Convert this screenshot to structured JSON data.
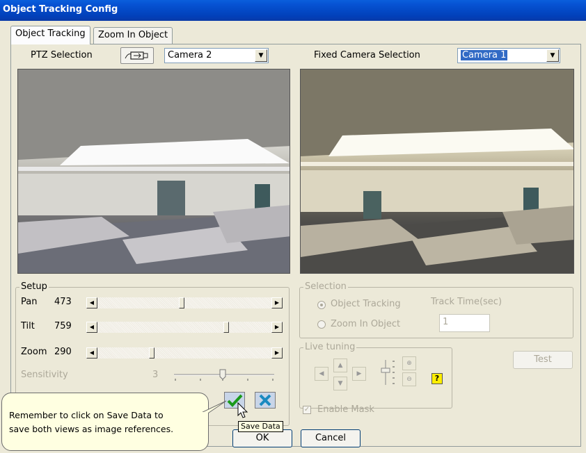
{
  "window": {
    "title": "Object Tracking Config"
  },
  "tabs": [
    {
      "label": "Object Tracking",
      "active": true
    },
    {
      "label": "Zoom In Object",
      "active": false
    }
  ],
  "ptz": {
    "label": "PTZ Selection",
    "camera": "Camera 2"
  },
  "fixed": {
    "label": "Fixed Camera Selection",
    "camera": "Camera 1"
  },
  "setup": {
    "label": "Setup",
    "pan_label": "Pan",
    "pan_value": "473",
    "tilt_label": "Tilt",
    "tilt_value": "759",
    "zoom_label": "Zoom",
    "zoom_value": "290",
    "sensitivity_label": "Sensitivity",
    "sensitivity_value": "3"
  },
  "selection": {
    "label": "Selection",
    "object_tracking": "Object Tracking",
    "zoom_in_object": "Zoom In Object",
    "track_time_label": "Track Time(sec)",
    "track_time_value": "1"
  },
  "live_tuning": {
    "label": "Live tuning"
  },
  "test_button": "Test",
  "enable_mask": "Enable Mask",
  "ok_button": "OK",
  "cancel_button": "Cancel",
  "tooltip": "Save Data",
  "callout": {
    "line1": "Remember to click on Save Data to",
    "line2": "save both views as image references."
  },
  "colors": {
    "titlebar": "#0349c6",
    "dialog_bg": "#ece9d8",
    "selection_highlight": "#316ac5",
    "callout_bg": "#ffffe1"
  },
  "icons": {
    "ptz_icon": "ptz-camera-icon",
    "save": "green-checkmark-icon",
    "clear": "blue-x-icon",
    "help": "help-question-icon"
  }
}
